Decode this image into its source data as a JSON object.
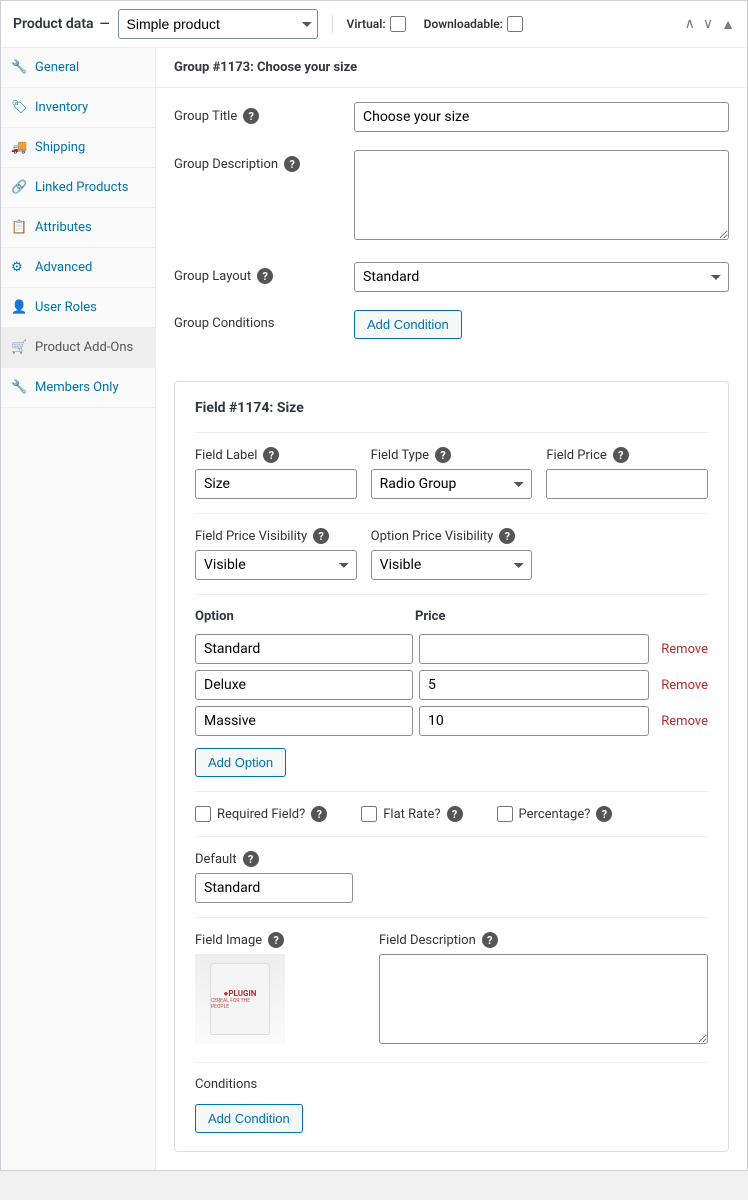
{
  "header": {
    "title": "Product data",
    "dash": "—",
    "product_type": "Simple product",
    "virtual_label": "Virtual:",
    "downloadable_label": "Downloadable:"
  },
  "sidebar": {
    "items": [
      {
        "label": "General"
      },
      {
        "label": "Inventory"
      },
      {
        "label": "Shipping"
      },
      {
        "label": "Linked Products"
      },
      {
        "label": "Attributes"
      },
      {
        "label": "Advanced"
      },
      {
        "label": "User Roles"
      },
      {
        "label": "Product Add-Ons"
      },
      {
        "label": "Members Only"
      }
    ]
  },
  "group": {
    "heading": "Group #1173: Choose your size",
    "title_label": "Group Title",
    "title_value": "Choose your size",
    "desc_label": "Group Description",
    "desc_value": "",
    "layout_label": "Group Layout",
    "layout_value": "Standard",
    "cond_label": "Group Conditions",
    "add_condition": "Add Condition"
  },
  "field": {
    "heading": "Field #1174: Size",
    "label_lbl": "Field Label",
    "label_val": "Size",
    "type_lbl": "Field Type",
    "type_val": "Radio Group",
    "price_lbl": "Field Price",
    "price_val": "",
    "fpv_lbl": "Field Price Visibility",
    "fpv_val": "Visible",
    "opv_lbl": "Option Price Visibility",
    "opv_val": "Visible",
    "option_hdr": "Option",
    "price_hdr": "Price",
    "options": [
      {
        "name": "Standard",
        "price": ""
      },
      {
        "name": "Deluxe",
        "price": "5"
      },
      {
        "name": "Massive",
        "price": "10"
      }
    ],
    "remove": "Remove",
    "add_option": "Add Option",
    "required_lbl": "Required Field?",
    "flatrate_lbl": "Flat Rate?",
    "percentage_lbl": "Percentage?",
    "default_lbl": "Default",
    "default_val": "Standard",
    "image_lbl": "Field Image",
    "image_brand": "●PLUGIN",
    "image_caption": "CEREAL FOR THE PEOPLE",
    "desc_lbl": "Field Description",
    "desc_val": "",
    "conditions_lbl": "Conditions",
    "add_condition": "Add Condition"
  }
}
